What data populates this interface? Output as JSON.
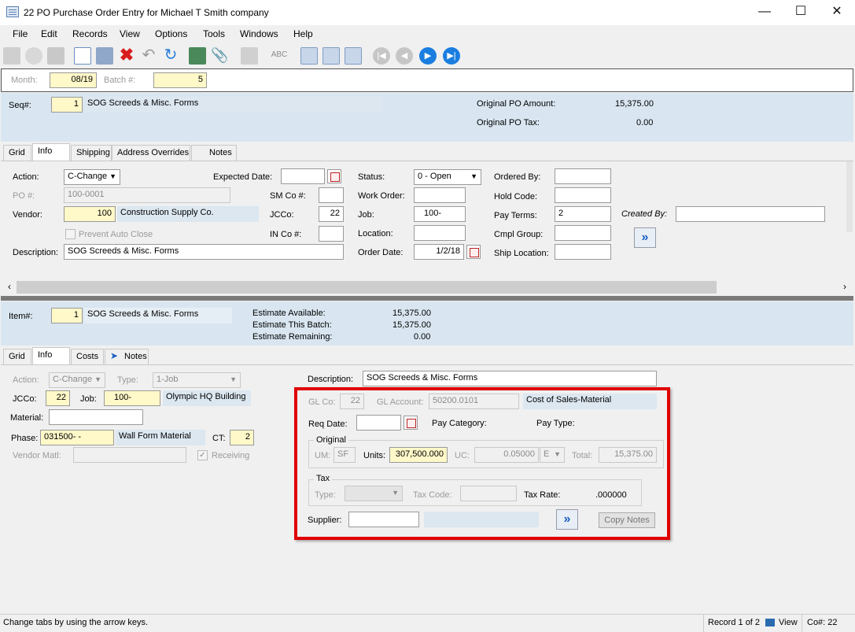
{
  "window": {
    "title": "22 PO Purchase Order Entry for Michael T Smith company"
  },
  "menu": [
    "File",
    "Edit",
    "Records",
    "View",
    "Options",
    "Tools",
    "Windows",
    "Help"
  ],
  "batch": {
    "month_label": "Month:",
    "month": "08/19",
    "batch_label": "Batch #:",
    "batch": "5"
  },
  "header": {
    "seq_label": "Seq#:",
    "seq": "1",
    "seq_desc": "SOG Screeds & Misc. Forms",
    "orig_amount_label": "Original PO Amount:",
    "orig_amount": "15,375.00",
    "orig_tax_label": "Original PO Tax:",
    "orig_tax": "0.00"
  },
  "tabs_top": [
    "Grid",
    "Info",
    "Shipping",
    "Address Overrides",
    "Notes"
  ],
  "po_info": {
    "action_label": "Action:",
    "action": "C-Change",
    "po_label": "PO #:",
    "po": "100-0001",
    "vendor_label": "Vendor:",
    "vendor": "100",
    "vendor_name": "Construction Supply Co.",
    "prevent_label": "Prevent Auto Close",
    "desc_label": "Description:",
    "desc": "SOG Screeds & Misc. Forms",
    "exp_date_label": "Expected Date:",
    "exp_date": "",
    "smco_label": "SM Co #:",
    "smco": "",
    "jcco_label": "JCCo:",
    "jcco": "22",
    "inco_label": "IN Co #:",
    "inco": "",
    "status_label": "Status:",
    "status": "0 - Open",
    "work_order_label": "Work Order:",
    "work_order": "",
    "job_label": "Job:",
    "job": "100-",
    "location_label": "Location:",
    "location": "",
    "order_date_label": "Order Date:",
    "order_date": "1/2/18",
    "ordered_by_label": "Ordered By:",
    "ordered_by": "",
    "hold_code_label": "Hold Code:",
    "hold_code": "",
    "pay_terms_label": "Pay Terms:",
    "pay_terms": "2",
    "cmpl_group_label": "Cmpl Group:",
    "cmpl_group": "",
    "ship_location_label": "Ship Location:",
    "ship_location": "",
    "created_by_label": "Created By:",
    "created_by": ""
  },
  "item_header": {
    "item_label": "Item#:",
    "item": "1",
    "item_desc": "SOG Screeds & Misc. Forms",
    "est_avail_label": "Estimate Available:",
    "est_avail": "15,375.00",
    "est_batch_label": "Estimate This Batch:",
    "est_batch": "15,375.00",
    "est_remain_label": "Estimate Remaining:",
    "est_remain": "0.00"
  },
  "tabs_bottom": [
    "Grid",
    "Info",
    "Costs",
    "Notes"
  ],
  "item_info": {
    "action_label": "Action:",
    "action": "C-Change",
    "type_label": "Type:",
    "type": "1-Job",
    "jcco_label": "JCCo:",
    "jcco": "22",
    "job_label": "Job:",
    "job": "100-",
    "job_name": "Olympic HQ Building",
    "material_label": "Material:",
    "material": "",
    "phase_label": "Phase:",
    "phase": "031500-  -",
    "phase_name": "Wall Form Material",
    "ct_label": "CT:",
    "ct": "2",
    "vendor_matl_label": "Vendor Matl:",
    "vendor_matl": "",
    "receiving_label": "Receiving",
    "desc_label": "Description:",
    "desc": "SOG Screeds & Misc. Forms",
    "glco_label": "GL Co:",
    "glco": "22",
    "glacct_label": "GL Account:",
    "glacct": "50200.0101",
    "glacct_name": "Cost of Sales-Material",
    "req_date_label": "Req Date:",
    "req_date": "",
    "pay_category_label": "Pay Category:",
    "pay_type_label": "Pay Type:",
    "original_label": "Original",
    "um_label": "UM:",
    "um": "SF",
    "units_label": "Units:",
    "units": "307,500.000",
    "uc_label": "UC:",
    "uc": "0.05000",
    "uc_unit": "E",
    "total_label": "Total:",
    "total": "15,375.00",
    "tax_label": "Tax",
    "tax_type_label": "Type:",
    "tax_code_label": "Tax Code:",
    "tax_rate_label": "Tax Rate:",
    "tax_rate": ".000000",
    "supplier_label": "Supplier:",
    "supplier": "",
    "copy_notes": "Copy Notes"
  },
  "status": {
    "message": "Change tabs by using the arrow keys.",
    "record": "Record 1 of 2",
    "view": "View",
    "co": "Co#: 22"
  },
  "colors": {
    "highlight": "#e00000",
    "input_yellow": "#fff8c8",
    "panel_blue": "#d9e6f1"
  }
}
